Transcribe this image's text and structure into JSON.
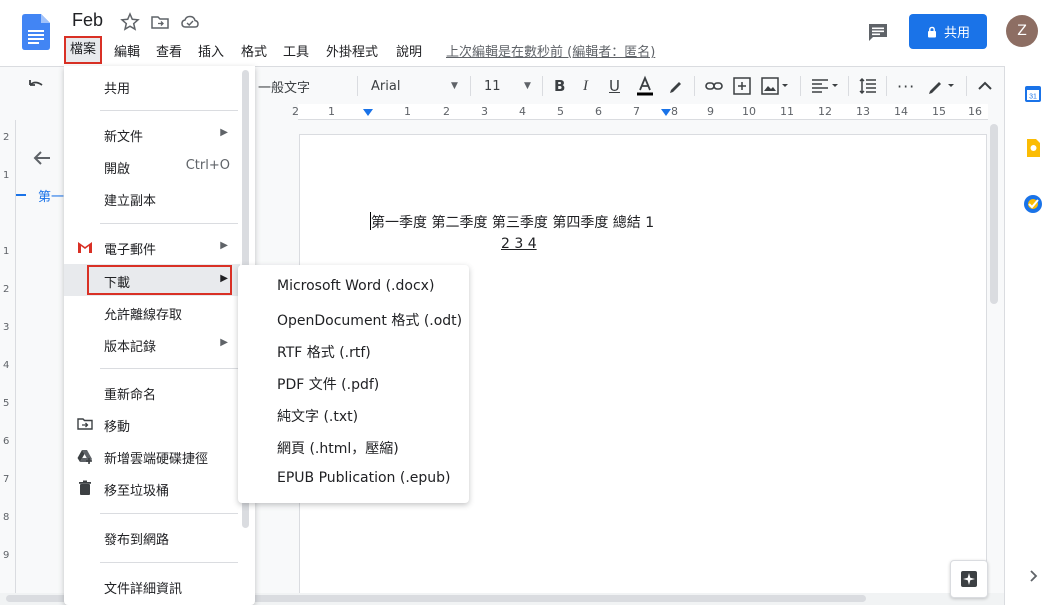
{
  "doc": {
    "title": "Feb",
    "last_edit": "上次編輯是在數秒前 (編輯者：匿名)"
  },
  "menubar": [
    "檔案",
    "編輯",
    "查看",
    "插入",
    "格式",
    "工具",
    "外掛程式",
    "說明"
  ],
  "header": {
    "share_label": "共用",
    "avatar_letter": "Z"
  },
  "toolbar": {
    "style_label": "一般文字",
    "font_label": "Arial",
    "size_label": "11"
  },
  "ruler": {
    "h_ticks": [
      "2",
      "1",
      "1",
      "2",
      "3",
      "4",
      "5",
      "6",
      "7",
      "8",
      "9",
      "10",
      "11",
      "12",
      "13",
      "14",
      "15",
      "16"
    ],
    "v_ticks": [
      "2",
      "1",
      "1",
      "2",
      "3",
      "4",
      "5",
      "6",
      "7",
      "8",
      "9"
    ]
  },
  "outline": {
    "item": "第一"
  },
  "document": {
    "line1": "第一季度 第二季度 第三季度 第四季度 總結 1",
    "line2": "2 3 4"
  },
  "file_menu": {
    "items": [
      {
        "label": "共用"
      },
      {
        "label": "新文件",
        "arrow": "▶"
      },
      {
        "label": "開啟",
        "shortcut": "Ctrl+O"
      },
      {
        "label": "建立副本"
      },
      {
        "label": "電子郵件",
        "arrow": "▶"
      },
      {
        "label": "下載",
        "arrow": "▶"
      },
      {
        "label": "允許離線存取"
      },
      {
        "label": "版本記錄",
        "arrow": "▶"
      },
      {
        "label": "重新命名"
      },
      {
        "label": "移動"
      },
      {
        "label": "新增雲端硬碟捷徑"
      },
      {
        "label": "移至垃圾桶"
      },
      {
        "label": "發布到網路"
      },
      {
        "label": "文件詳細資訊"
      }
    ]
  },
  "download_submenu": {
    "items": [
      "Microsoft Word (.docx)",
      "OpenDocument 格式 (.odt)",
      "RTF 格式 (.rtf)",
      "PDF 文件 (.pdf)",
      "純文字 (.txt)",
      "網頁 (.html，壓縮)",
      "EPUB Publication (.epub)"
    ]
  },
  "colors": {
    "accent": "#1a73e8",
    "highlight_border": "#d93025",
    "calendar": "#1a73e8",
    "keep": "#fbbc04",
    "tasks": "#1a73e8"
  }
}
